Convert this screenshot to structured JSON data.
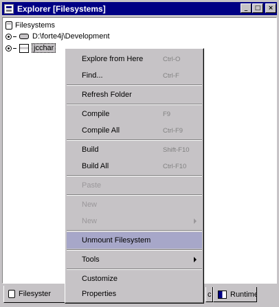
{
  "window": {
    "title": "Explorer [Filesystems]"
  },
  "tree": {
    "root_label": "Filesystems",
    "items": [
      {
        "label": "D:\\forte4j\\Development"
      },
      {
        "label": "jcchar"
      }
    ]
  },
  "tabs": [
    {
      "label": "Filesystems",
      "visible_text": "Filesyster"
    },
    {
      "label_fragment": "c"
    },
    {
      "label": "Runtime"
    }
  ],
  "context_menu": {
    "items": [
      {
        "label": "Explore from Here",
        "shortcut": "Ctrl-O"
      },
      {
        "label": "Find...",
        "shortcut": "Ctrl-F"
      },
      {
        "label": "Refresh Folder"
      },
      {
        "label": "Compile",
        "shortcut": "F9"
      },
      {
        "label": "Compile All",
        "shortcut": "Ctrl-F9"
      },
      {
        "label": "Build",
        "shortcut": "Shift-F10"
      },
      {
        "label": "Build All",
        "shortcut": "Ctrl-F10"
      },
      {
        "label": "Paste",
        "disabled": true
      },
      {
        "label": "New",
        "disabled": true
      },
      {
        "label": "New",
        "disabled": true,
        "submenu": true
      },
      {
        "label": "Unmount Filesystem",
        "highlighted": true
      },
      {
        "label": "Tools",
        "submenu": true
      },
      {
        "label": "Customize"
      },
      {
        "label": "Properties"
      }
    ]
  },
  "colors": {
    "titlebar": "#000084",
    "highlight": "#a7a7c9",
    "face": "#c6c3c6"
  }
}
